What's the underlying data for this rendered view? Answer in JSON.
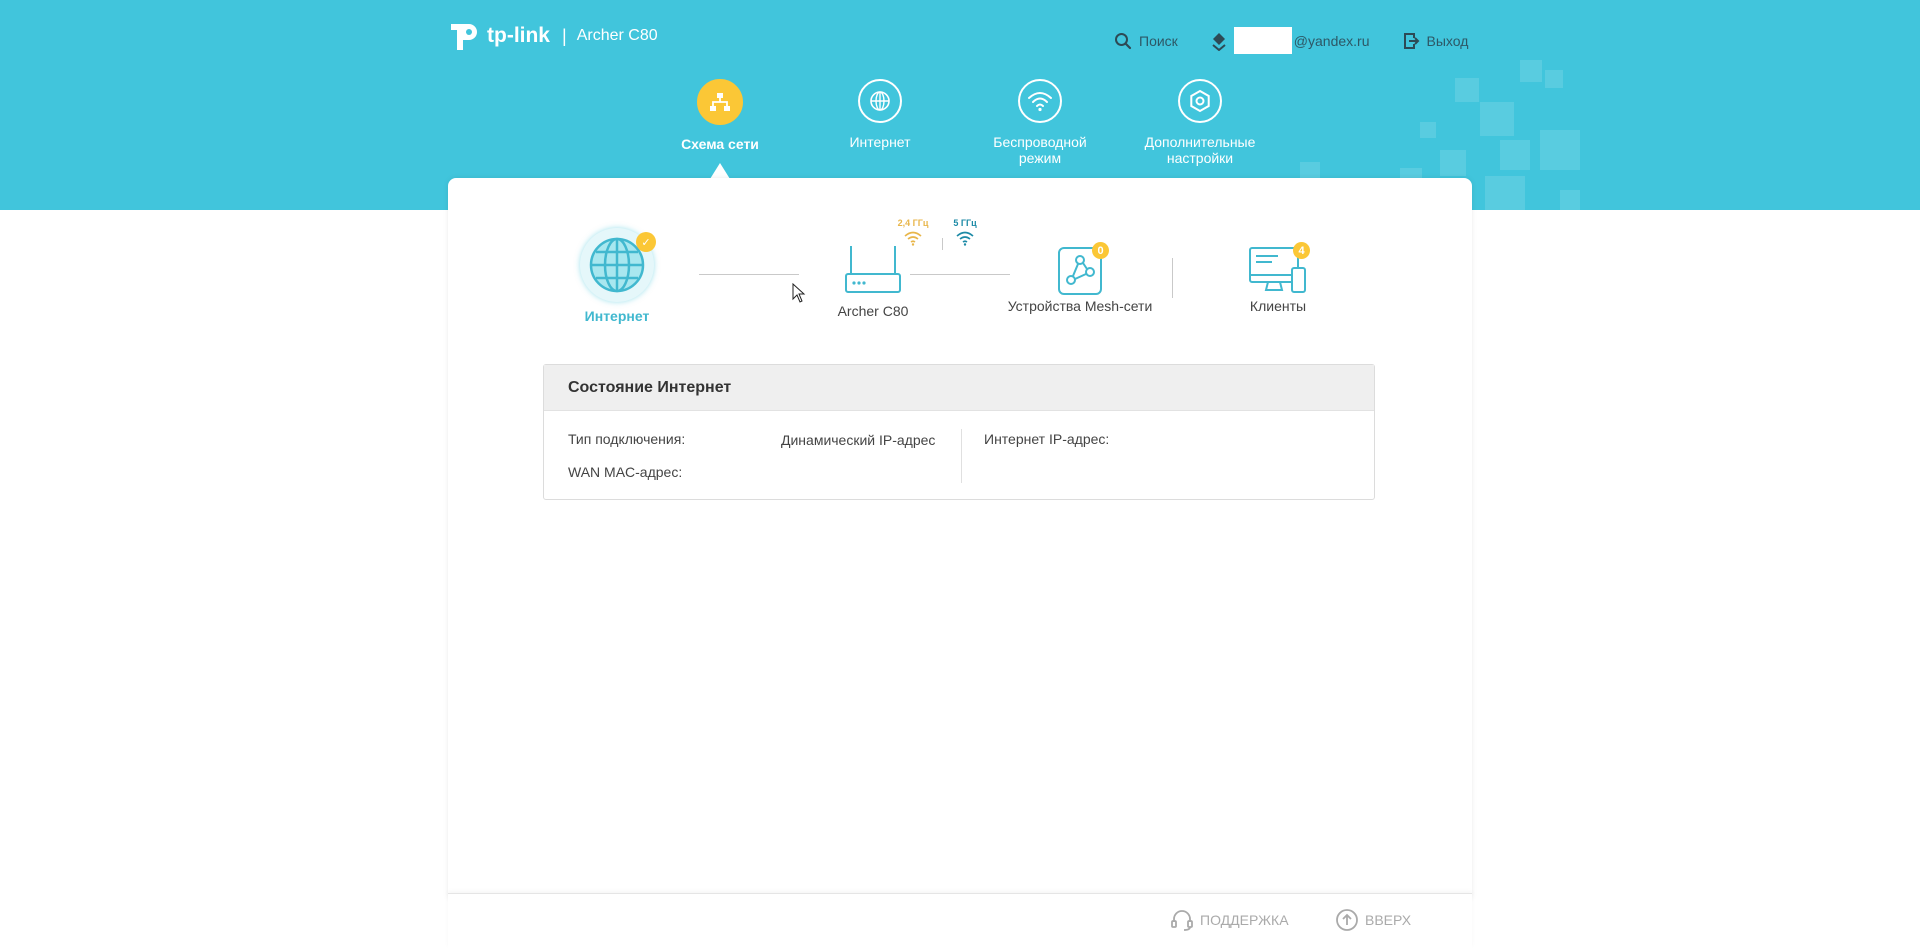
{
  "header": {
    "brand": "tp-link",
    "separator": "|",
    "model": "Archer C80",
    "search_label": "Поиск",
    "account_suffix": "@yandex.ru",
    "logout_label": "Выход"
  },
  "nav": {
    "items": [
      {
        "label1": "Схема сети",
        "label2": "",
        "icon": "network-map-icon",
        "active": true
      },
      {
        "label1": "Интернет",
        "label2": "",
        "icon": "globe-icon",
        "active": false
      },
      {
        "label1": "Беспроводной",
        "label2": "режим",
        "icon": "wifi-icon",
        "active": false
      },
      {
        "label1": "Дополнительные",
        "label2": "настройки",
        "icon": "gear-icon",
        "active": false
      }
    ]
  },
  "topology": {
    "internet_label": "Интернет",
    "router_label": "Archer C80",
    "band_24": "2,4 ГГц",
    "band_5": "5 ГГц",
    "mesh_label": "Устройства Mesh-сети",
    "mesh_count": "0",
    "clients_label": "Клиенты",
    "clients_count": "4"
  },
  "status": {
    "title": "Состояние Интернет",
    "conn_type_label": "Тип подключения:",
    "conn_type_value": "Динамический IP-адрес",
    "wan_mac_label": "WAN MAC-адрес:",
    "wan_mac_value": "",
    "ip_label": "Интернет IP-адрес:",
    "ip_value": ""
  },
  "footer": {
    "support_label": "ПОДДЕРЖКА",
    "top_label": "ВВЕРХ"
  },
  "colors": {
    "header_bg": "#41c5dc",
    "accent_yellow": "#fbc736",
    "accent_teal": "#41b8cf"
  }
}
